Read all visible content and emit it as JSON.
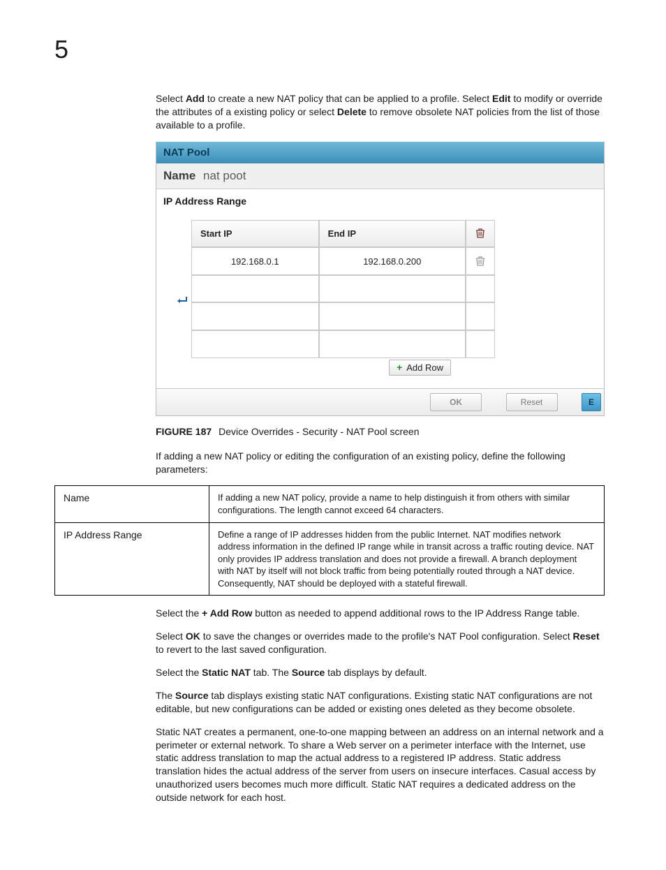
{
  "chapter_number": "5",
  "intro": {
    "pre1": "Select ",
    "add": "Add",
    "mid1": " to create a new NAT policy that can be applied to a profile. Select ",
    "edit": "Edit",
    "mid2": " to modify or override the attributes of a existing policy or select ",
    "delete": "Delete",
    "post": " to remove obsolete NAT policies from the list of those available to a profile."
  },
  "panel": {
    "title": "NAT Pool",
    "name_label": "Name",
    "name_value": "nat poot",
    "fieldset_title": "IP Address Range",
    "columns": {
      "start": "Start IP",
      "end": "End IP"
    },
    "rows": [
      {
        "start": "192.168.0.1",
        "end": "192.168.0.200"
      },
      {
        "start": "",
        "end": ""
      },
      {
        "start": "",
        "end": ""
      },
      {
        "start": "",
        "end": ""
      }
    ],
    "add_row_label": "Add Row",
    "footer": {
      "ok": "OK",
      "reset": "Reset",
      "exit_fragment": "E"
    }
  },
  "caption": {
    "label": "FIGURE 187",
    "text": "Device Overrides - Security - NAT Pool screen"
  },
  "after_panel_intro": "If adding a new NAT policy or editing the configuration of an existing policy, define the following parameters:",
  "params": [
    {
      "key": "Name",
      "desc": "If adding a new NAT policy, provide a name to help distinguish it from others with similar configurations. The length cannot exceed 64 characters."
    },
    {
      "key": "IP Address Range",
      "desc": "Define a range of IP addresses hidden from the public Internet. NAT modifies network address information in the defined IP range while in transit across a traffic routing device. NAT only provides IP address translation and does not provide a firewall. A branch deployment with NAT by itself will not block traffic from being potentially routed through a NAT device. Consequently, NAT should be deployed with a stateful firewall."
    }
  ],
  "trailing": {
    "p1a": "Select the ",
    "p1b": "+ Add Row",
    "p1c": " button as needed to append additional rows to the IP Address Range table.",
    "p2a": "Select ",
    "p2b": "OK",
    "p2c": " to save the changes or overrides made to the profile's NAT Pool configuration. Select ",
    "p2d": "Reset",
    "p2e": " to revert to the last saved configuration.",
    "p3a": "Select the ",
    "p3b": "Static NAT",
    "p3c": " tab. The ",
    "p3d": "Source",
    "p3e": " tab displays by default.",
    "p4a": "The ",
    "p4b": "Source",
    "p4c": " tab displays existing static NAT configurations. Existing static NAT configurations are not editable, but new configurations can be added or existing ones deleted as they become obsolete.",
    "p5": "Static NAT creates a permanent, one-to-one mapping between an address on an internal network and a perimeter or external network. To share a Web server on a perimeter interface with the Internet, use static address translation to map the actual address to a registered IP address. Static address translation hides the actual address of the server from users on insecure interfaces. Casual access by unauthorized users becomes much more difficult. Static NAT requires a dedicated address on the outside network for each host."
  }
}
